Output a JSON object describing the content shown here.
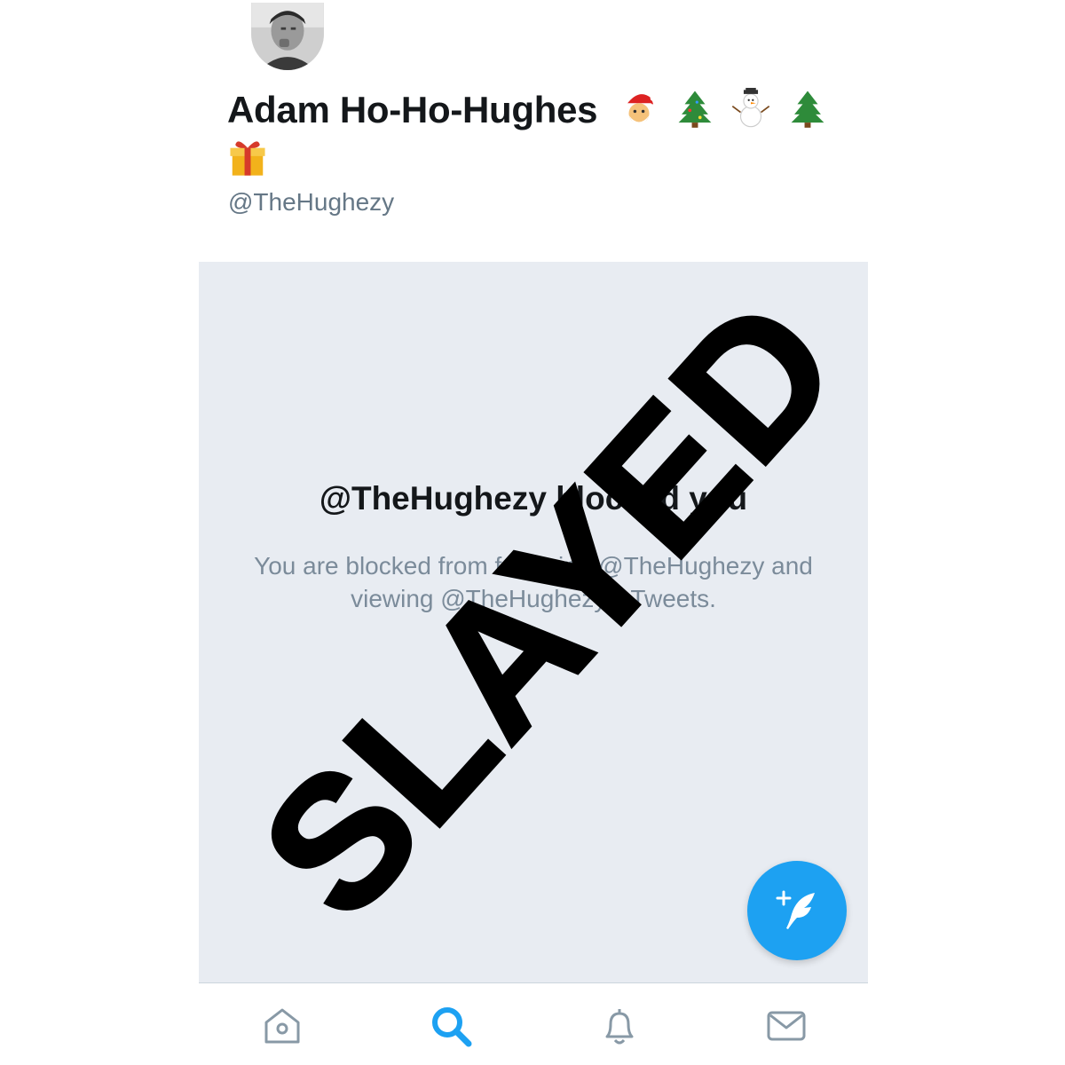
{
  "profile": {
    "display_name": "Adam Ho-Ho-Hughes",
    "display_name_emojis": [
      "santa-emoji",
      "christmas-tree-emoji",
      "snowman-emoji",
      "christmas-tree-emoji",
      "wrapped-gift-emoji"
    ],
    "handle": "@TheHughezy",
    "avatar": "profile-photo"
  },
  "blocked": {
    "title": "@TheHughezy blocked you",
    "description": "You are blocked from following @TheHughezy and viewing @TheHughezy’s Tweets."
  },
  "overlay": {
    "stamp_text": "SLAYED"
  },
  "compose": {
    "icon": "compose-tweet-icon"
  },
  "tab_bar": {
    "tabs": [
      {
        "name": "home",
        "icon": "home-icon",
        "active": false
      },
      {
        "name": "search",
        "icon": "search-icon",
        "active": true
      },
      {
        "name": "notifications",
        "icon": "bell-icon",
        "active": false
      },
      {
        "name": "messages",
        "icon": "mail-icon",
        "active": false
      }
    ]
  },
  "colors": {
    "accent": "#1da1f2",
    "panel_bg": "#e8ecf2",
    "muted_text": "#657786",
    "icon_gray": "#8899a6"
  }
}
